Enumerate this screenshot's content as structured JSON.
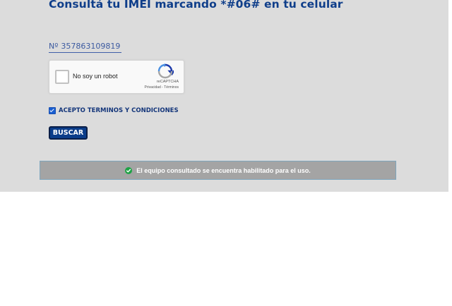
{
  "header": {
    "title": "Consultá tu IMEI marcando *#06# en tu celular"
  },
  "imei": {
    "prefix": "Nº",
    "value": "357863109819"
  },
  "recaptcha": {
    "label": "No soy un robot",
    "brand": "reCAPTCHA",
    "links": "Privacidad - Términos",
    "checked": false
  },
  "terms": {
    "label": "ACEPTO TERMINOS Y CONDICIONES",
    "checked": true
  },
  "search": {
    "button_label": "BUSCAR"
  },
  "result": {
    "message": "El equipo consultado se encuentra habilitado para el uso.",
    "status": "success"
  },
  "colors": {
    "brand_blue": "#0f3e8a",
    "panel_bg": "#dcdcdc",
    "success_green": "#1fa346"
  }
}
